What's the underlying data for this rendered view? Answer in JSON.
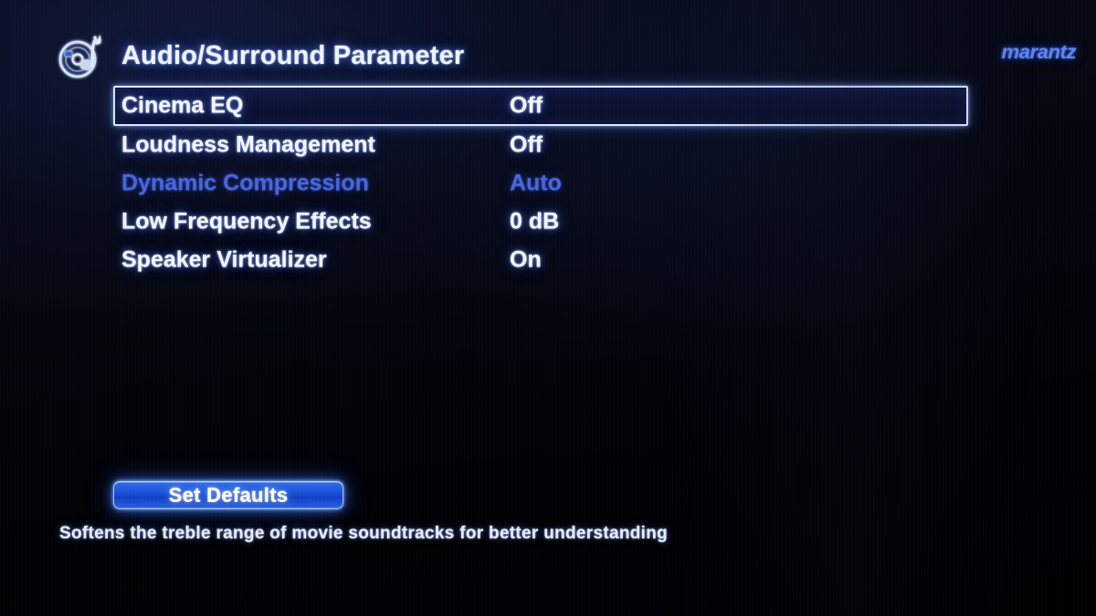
{
  "header": {
    "icon_name": "disc-music-note-icon",
    "title": "Audio/Surround Parameter",
    "brand": "marantz"
  },
  "colors": {
    "text_active": "#f2f6ff",
    "text_dimmed": "#4a66d8",
    "brand": "#5f86ef",
    "button_fill": "#1a50d8",
    "selection_border": "#dfe8ff",
    "background": "#05070f"
  },
  "parameters": [
    {
      "label": "Cinema EQ",
      "value": "Off",
      "selected": true,
      "enabled": true
    },
    {
      "label": "Loudness Management",
      "value": "Off",
      "selected": false,
      "enabled": true
    },
    {
      "label": "Dynamic Compression",
      "value": "Auto",
      "selected": false,
      "enabled": false
    },
    {
      "label": "Low Frequency Effects",
      "value": "0 dB",
      "selected": false,
      "enabled": true
    },
    {
      "label": "Speaker Virtualizer",
      "value": "On",
      "selected": false,
      "enabled": true
    }
  ],
  "actions": {
    "set_defaults_label": "Set Defaults"
  },
  "help": {
    "text": "Softens the treble range of movie soundtracks for better understanding"
  }
}
